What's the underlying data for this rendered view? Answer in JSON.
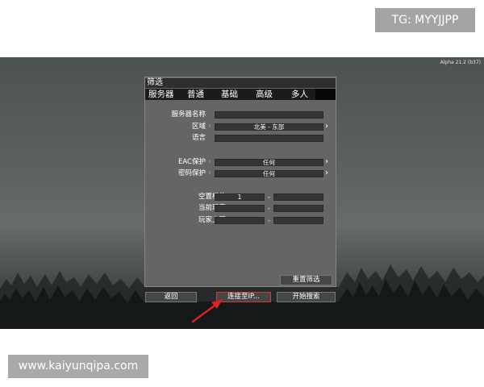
{
  "watermarks": {
    "tg": "TG: MYYJJPP",
    "url": "www.kaiyunqipa.com"
  },
  "game": {
    "version": "Alpha 21.2 (b37)"
  },
  "panel": {
    "title": "筛选",
    "tabs": [
      {
        "label": "服务器"
      },
      {
        "label": "普通"
      },
      {
        "label": "基础"
      },
      {
        "label": "高级"
      },
      {
        "label": "多人"
      }
    ],
    "rows": {
      "server_name": {
        "label": "服务器名称",
        "value": ""
      },
      "region": {
        "label": "区域",
        "value": "北美 - 东部"
      },
      "language": {
        "label": "语言",
        "value": ""
      },
      "eac": {
        "label": "EAC保护",
        "value": "任何"
      },
      "password": {
        "label": "密码保护",
        "value": "任何"
      },
      "free_slots": {
        "label": "空置栏位",
        "min": "1",
        "max": ""
      },
      "current_players": {
        "label": "当前玩家",
        "min": "",
        "max": ""
      },
      "player_limit": {
        "label": "玩家上限",
        "min": "",
        "max": ""
      }
    },
    "range_separator": "-",
    "reset_label": "重置筛选"
  },
  "buttons": {
    "back": "返回",
    "connect_ip": "连接至IP...",
    "start_search": "开始搜索"
  },
  "colors": {
    "panel_bg": "#656565",
    "tab_bar": "#1b1b1b",
    "field_bg": "#353535",
    "highlight_border": "#d23a3a",
    "annotation_arrow": "#e02020"
  },
  "icons": {
    "arrow_left": "‹",
    "arrow_right": "›"
  }
}
